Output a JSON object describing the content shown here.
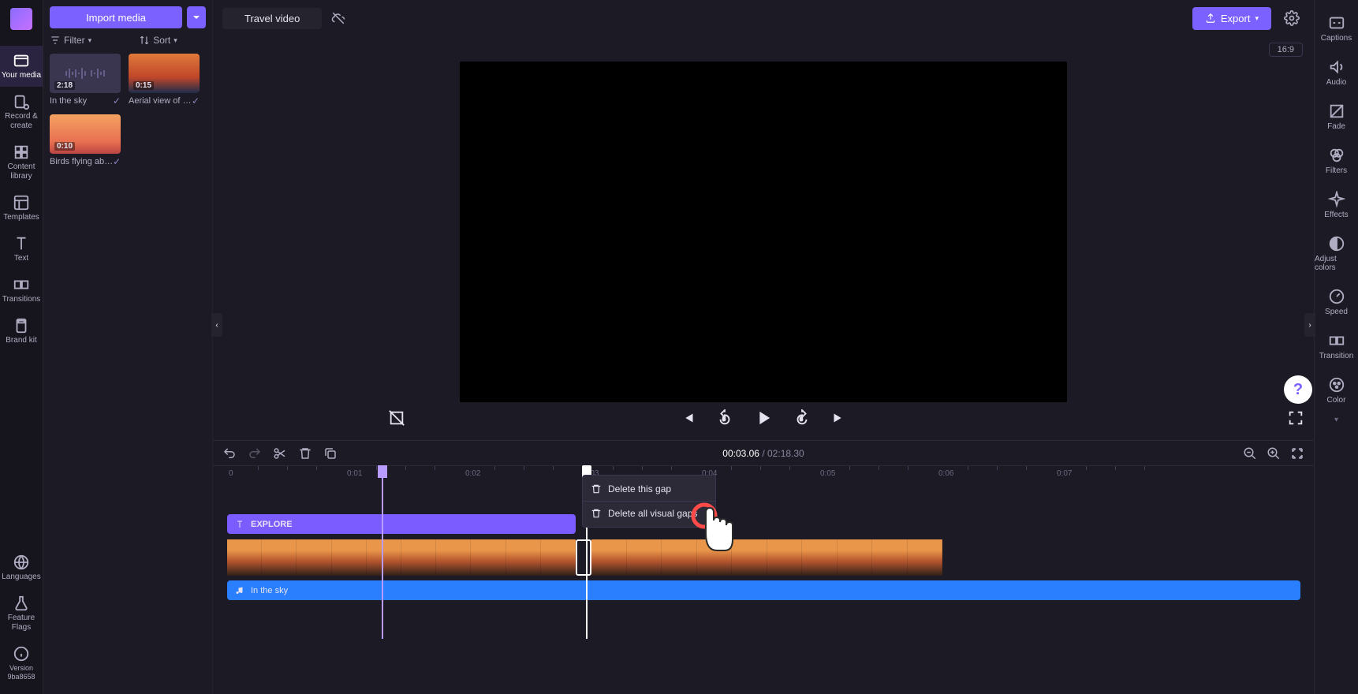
{
  "project_title": "Travel video",
  "import_button": "Import media",
  "filter_label": "Filter",
  "sort_label": "Sort",
  "export_label": "Export",
  "aspect_ratio": "16:9",
  "time": {
    "current": "00:03.06",
    "total": "02:18.30"
  },
  "left_rail": [
    {
      "label": "Your media",
      "active": true
    },
    {
      "label": "Record & create"
    },
    {
      "label": "Content library"
    },
    {
      "label": "Templates"
    },
    {
      "label": "Text"
    },
    {
      "label": "Transitions"
    },
    {
      "label": "Brand kit"
    }
  ],
  "left_rail_bottom": [
    {
      "label": "Languages"
    },
    {
      "label": "Feature Flags"
    },
    {
      "label": "Version 9ba8658"
    }
  ],
  "media_items": [
    {
      "name": "In the sky",
      "duration": "2:18",
      "kind": "audio"
    },
    {
      "name": "Aerial view of …",
      "duration": "0:15",
      "kind": "sunset"
    },
    {
      "name": "Birds flying ab…",
      "duration": "0:10",
      "kind": "birds"
    }
  ],
  "right_rail": [
    "Captions",
    "Audio",
    "Fade",
    "Filters",
    "Effects",
    "Adjust colors",
    "Speed",
    "Transition",
    "Color"
  ],
  "ruler_ticks": [
    "0",
    "0:01",
    "0:02",
    "0:03",
    "0:04",
    "0:05",
    "0:06",
    "0:07"
  ],
  "context_menu": {
    "item1": "Delete this gap",
    "item2": "Delete all visual gaps"
  },
  "tracks": {
    "text_label": "EXPLORE",
    "audio_label": "In the sky"
  }
}
